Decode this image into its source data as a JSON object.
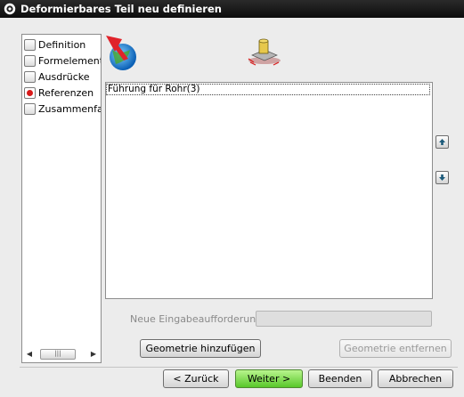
{
  "window": {
    "title": "Deformierbares Teil neu definieren"
  },
  "steps": [
    {
      "label": "Definition",
      "active": false
    },
    {
      "label": "Formelement",
      "active": false
    },
    {
      "label": "Ausdrücke",
      "active": false
    },
    {
      "label": "Referenzen",
      "active": true
    },
    {
      "label": "Zusammenfas",
      "active": false
    }
  ],
  "icons": {
    "title": "gear-icon",
    "wizard": "globe-arrow-icon",
    "step": "deformable-part-icon",
    "move_up": "arrow-up-icon",
    "move_down": "arrow-down-icon"
  },
  "list": {
    "items": [
      "Führung für Rohr(3)"
    ]
  },
  "prompt": {
    "label": "Neue Eingabeaufforderung",
    "value": ""
  },
  "buttons": {
    "add_geometry": "Geometrie hinzufügen",
    "remove_geometry": "Geometrie entfernen",
    "back": "< Zurück",
    "next": "Weiter >",
    "finish": "Beenden",
    "cancel": "Abbrechen"
  },
  "colors": {
    "titlebar": "#111111",
    "active_step": "#d81a1a",
    "primary_button": "#6fd33e"
  }
}
